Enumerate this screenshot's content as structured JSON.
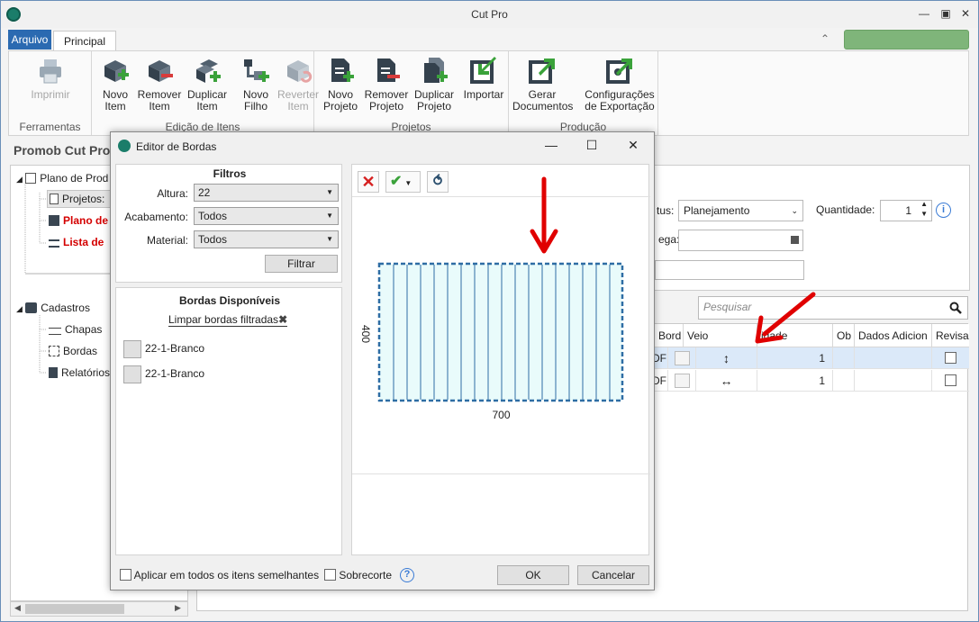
{
  "window": {
    "title": "Cut Pro",
    "controls": [
      "minimize",
      "maximize",
      "close"
    ]
  },
  "ribbon_tabs": [
    {
      "label": "Arquivo",
      "active": false
    },
    {
      "label": "Principal",
      "active": true
    }
  ],
  "ribbon_groups": [
    {
      "label": "Ferramentas",
      "buttons": [
        {
          "label": "Imprimir",
          "icon": "printer-icon",
          "enabled": false
        }
      ]
    },
    {
      "label": "Edição de Itens",
      "buttons": [
        {
          "label": "Novo Item",
          "icon": "new-item-icon",
          "enabled": true
        },
        {
          "label": "Remover Item",
          "icon": "remove-item-icon",
          "enabled": true
        },
        {
          "label": "Duplicar Item",
          "icon": "duplicate-item-icon",
          "enabled": true
        },
        {
          "label": "Novo Filho",
          "icon": "new-child-icon",
          "enabled": true
        },
        {
          "label": "Reverter Item",
          "icon": "revert-item-icon",
          "enabled": false
        }
      ]
    },
    {
      "label": "Projetos",
      "buttons": [
        {
          "label": "Novo Projeto",
          "icon": "new-project-icon",
          "enabled": true
        },
        {
          "label": "Remover Projeto",
          "icon": "remove-project-icon",
          "enabled": true
        },
        {
          "label": "Duplicar Projeto",
          "icon": "duplicate-project-icon",
          "enabled": true
        },
        {
          "label": "Importar",
          "icon": "import-icon",
          "enabled": true
        }
      ]
    },
    {
      "label": "Produção",
      "buttons": [
        {
          "label": "Gerar Documentos",
          "icon": "generate-docs-icon",
          "enabled": true
        },
        {
          "label": "Configurações de Exportação",
          "icon": "export-settings-icon",
          "enabled": true
        }
      ]
    }
  ],
  "left_panel": {
    "title": "Promob Cut Pro",
    "tree": {
      "plano": "Plano de Prod",
      "projetos": "Projetos:",
      "plano_corte": "Plano de",
      "lista": "Lista de",
      "cadastros": "Cadastros",
      "chapas": "Chapas",
      "bordas": "Bordas",
      "relatorios": "Relatórios"
    }
  },
  "main": {
    "status_label": "tus:",
    "status_value": "Planejamento",
    "quantidade_label": "Quantidade:",
    "quantidade_value": "1",
    "entrega_label": "ega:",
    "search_placeholder": "Pesquisar",
    "grid": {
      "columns": [
        "Bord",
        "Veio",
        "idade",
        "Ob",
        "Dados Adicion",
        "Revisa"
      ],
      "rows": [
        {
          "prefix": "DF",
          "quantity": "1",
          "grain": "vertical"
        },
        {
          "prefix": "DF",
          "quantity": "1",
          "grain": "horizontal"
        }
      ]
    }
  },
  "dialog": {
    "title": "Editor de Bordas",
    "filters": {
      "title": "Filtros",
      "altura_label": "Altura:",
      "altura_value": "22",
      "acabamento_label": "Acabamento:",
      "acabamento_value": "Todos",
      "material_label": "Material:",
      "material_value": "Todos",
      "button": "Filtrar"
    },
    "available": {
      "title": "Bordas Disponíveis",
      "clear_link": "Limpar bordas filtradas",
      "items": [
        "22-1-Branco",
        "22-1-Branco"
      ]
    },
    "preview": {
      "width_label": "700",
      "height_label": "400"
    },
    "footer": {
      "apply_all": "Aplicar em todos os itens semelhantes",
      "overcut": "Sobrecorte",
      "ok": "OK",
      "cancel": "Cancelar"
    }
  },
  "colors": {
    "accent": "#2b6ab1",
    "green_status": "#7fb57a",
    "red_arrow": "#e00000",
    "piece_fill": "#e9fbfb",
    "piece_border": "#2e6da4"
  }
}
